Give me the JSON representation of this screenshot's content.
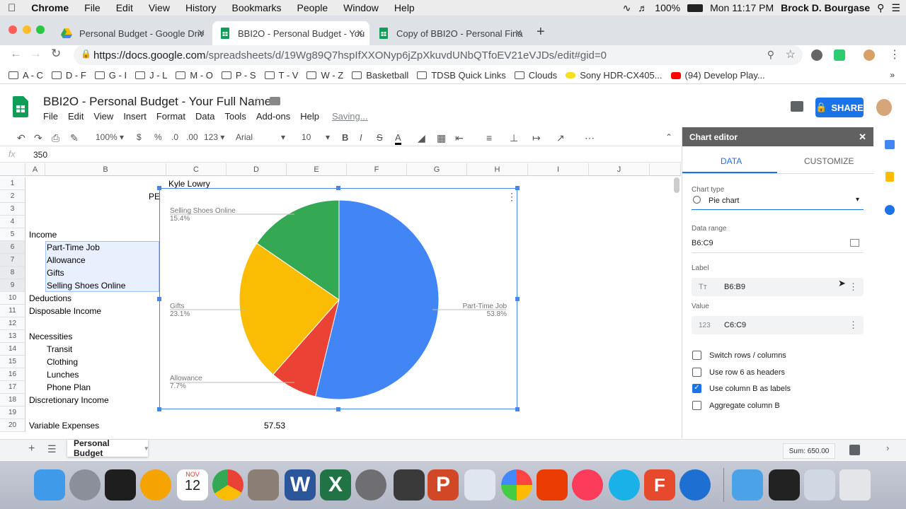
{
  "macmenu": {
    "apple": "",
    "app": "Chrome",
    "items": [
      "File",
      "Edit",
      "View",
      "History",
      "Bookmarks",
      "People",
      "Window",
      "Help"
    ],
    "battery": "100%",
    "clock": "Mon 11:17 PM",
    "user": "Brock D. Bourgase"
  },
  "tabs": [
    {
      "label": "Personal Budget - Google Driv",
      "icon": "google-drive-icon",
      "active": false
    },
    {
      "label": "BBI2O - Personal Budget - You",
      "icon": "sheets-icon",
      "active": true
    },
    {
      "label": "Copy of BBI2O - Personal Fina",
      "icon": "sheets-icon",
      "active": false
    }
  ],
  "omnibox": {
    "host": "https://docs.google.com",
    "path": "/spreadsheets/d/19Wg89Q7hspIfXXONyp6jZpXkuvdUNbQTfoEV21eVJDs/edit#gid=0"
  },
  "bookmarks": [
    "A - C",
    "D - F",
    "G - I",
    "J - L",
    "M - O",
    "P - S",
    "T - V",
    "W - Z",
    "Basketball",
    "TDSB Quick Links",
    "Clouds",
    "Sony HDR-CX405...",
    "(94) Develop Play..."
  ],
  "doc": {
    "title": "BBI2O - Personal Budget - Your Full Name",
    "menus": [
      "File",
      "Edit",
      "View",
      "Insert",
      "Format",
      "Data",
      "Tools",
      "Add-ons",
      "Help"
    ],
    "saving": "Saving...",
    "share": "SHARE"
  },
  "format": {
    "zoom": "100%",
    "currency": "$",
    "percent": "%",
    "dec_less": ".0",
    "dec_more": ".00",
    "more_formats": "123",
    "font": "Arial",
    "size": "10"
  },
  "formula": {
    "fx": "fx",
    "value": "350"
  },
  "columns": [
    "A",
    "B",
    "C",
    "D",
    "E",
    "F",
    "G",
    "H",
    "I",
    "J"
  ],
  "rows": [
    "1",
    "2",
    "3",
    "4",
    "5",
    "6",
    "7",
    "8",
    "9",
    "10",
    "11",
    "12",
    "13",
    "14",
    "15",
    "16",
    "17",
    "18",
    "19",
    "20"
  ],
  "cells": {
    "c1": "Kyle Lowry",
    "b2": "PE",
    "a5": "Income",
    "b6": "Part-Time Job",
    "b7": "Allowance",
    "b8": "Gifts",
    "b9": "Selling Shoes Online",
    "a10": "Deductions",
    "a11": "Disposable Income",
    "a13": "Necessities",
    "b14": "Transit",
    "b15": "Clothing",
    "b16": "Lunches",
    "b17": "Phone Plan",
    "a18": "Discretionary Income",
    "a20": "Variable Expenses",
    "d20": "57.53"
  },
  "chart_data": {
    "type": "pie",
    "categories": [
      "Part-Time Job",
      "Allowance",
      "Gifts",
      "Selling Shoes Online"
    ],
    "values": [
      53.8,
      7.7,
      23.1,
      15.4
    ],
    "labels": [
      "53.8%",
      "7.7%",
      "23.1%",
      "15.4%"
    ],
    "colors": [
      "#4285f4",
      "#ea4335",
      "#fbbc04",
      "#34a853"
    ]
  },
  "editor": {
    "title": "Chart editor",
    "tab_data": "DATA",
    "tab_customize": "CUSTOMIZE",
    "chart_type_label": "Chart type",
    "chart_type": "Pie chart",
    "range_label": "Data range",
    "range": "B6:C9",
    "label_label": "Label",
    "label_value": "B6:B9",
    "value_label": "Value",
    "value_value": "C6:C9",
    "checks": [
      {
        "label": "Switch rows / columns",
        "checked": false
      },
      {
        "label": "Use row 6 as headers",
        "checked": false
      },
      {
        "label": "Use column B as labels",
        "checked": true
      },
      {
        "label": "Aggregate column B",
        "checked": false
      }
    ]
  },
  "sheetbar": {
    "add": "+",
    "sheet": "Personal Budget",
    "sum": "Sum: 650.00"
  },
  "dock": {
    "calendar_month": "NOV",
    "calendar_day": "12"
  }
}
